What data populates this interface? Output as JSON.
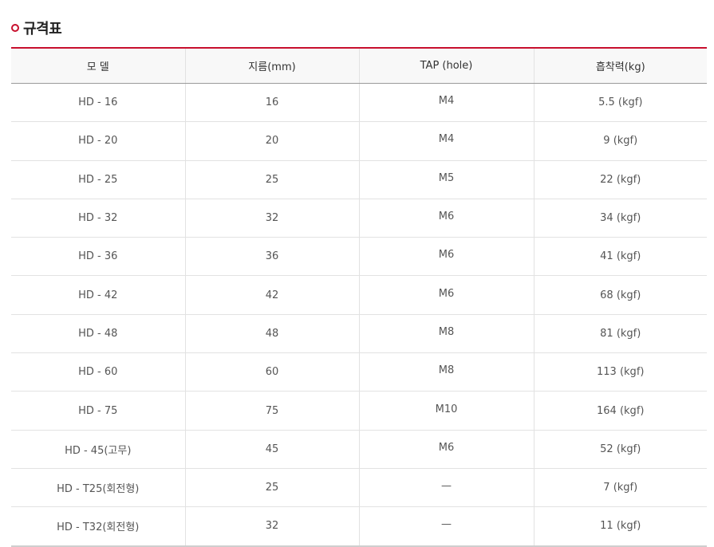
{
  "section": {
    "title": "규격표"
  },
  "table": {
    "headers": [
      "모 델",
      "지름(mm)",
      "TAP (hole)",
      "흡착력(kg)"
    ],
    "rows": [
      [
        "HD - 16",
        "16",
        "M4",
        "5.5 (kgf)"
      ],
      [
        "HD - 20",
        "20",
        "M4",
        "9 (kgf)"
      ],
      [
        "HD - 25",
        "25",
        "M5",
        "22 (kgf)"
      ],
      [
        "HD - 32",
        "32",
        "M6",
        "34 (kgf)"
      ],
      [
        "HD - 36",
        "36",
        "M6",
        "41 (kgf)"
      ],
      [
        "HD - 42",
        "42",
        "M6",
        "68 (kgf)"
      ],
      [
        "HD - 48",
        "48",
        "M8",
        "81 (kgf)"
      ],
      [
        "HD - 60",
        "60",
        "M8",
        "113 (kgf)"
      ],
      [
        "HD - 75",
        "75",
        "M10",
        "164 (kgf)"
      ],
      [
        "HD - 45(고무)",
        "45",
        "M6",
        "52 (kgf)"
      ],
      [
        "HD - T25(회전형)",
        "25",
        "—",
        "7 (kgf)"
      ],
      [
        "HD - T32(회전형)",
        "32",
        "—",
        "11 (kgf)"
      ]
    ]
  },
  "colors": {
    "accent": "#c8102e",
    "header_bg": "#f8f8f8",
    "grid": "#e2e2e2"
  },
  "icons": {
    "title_bullet": "circle-bullet-icon"
  }
}
